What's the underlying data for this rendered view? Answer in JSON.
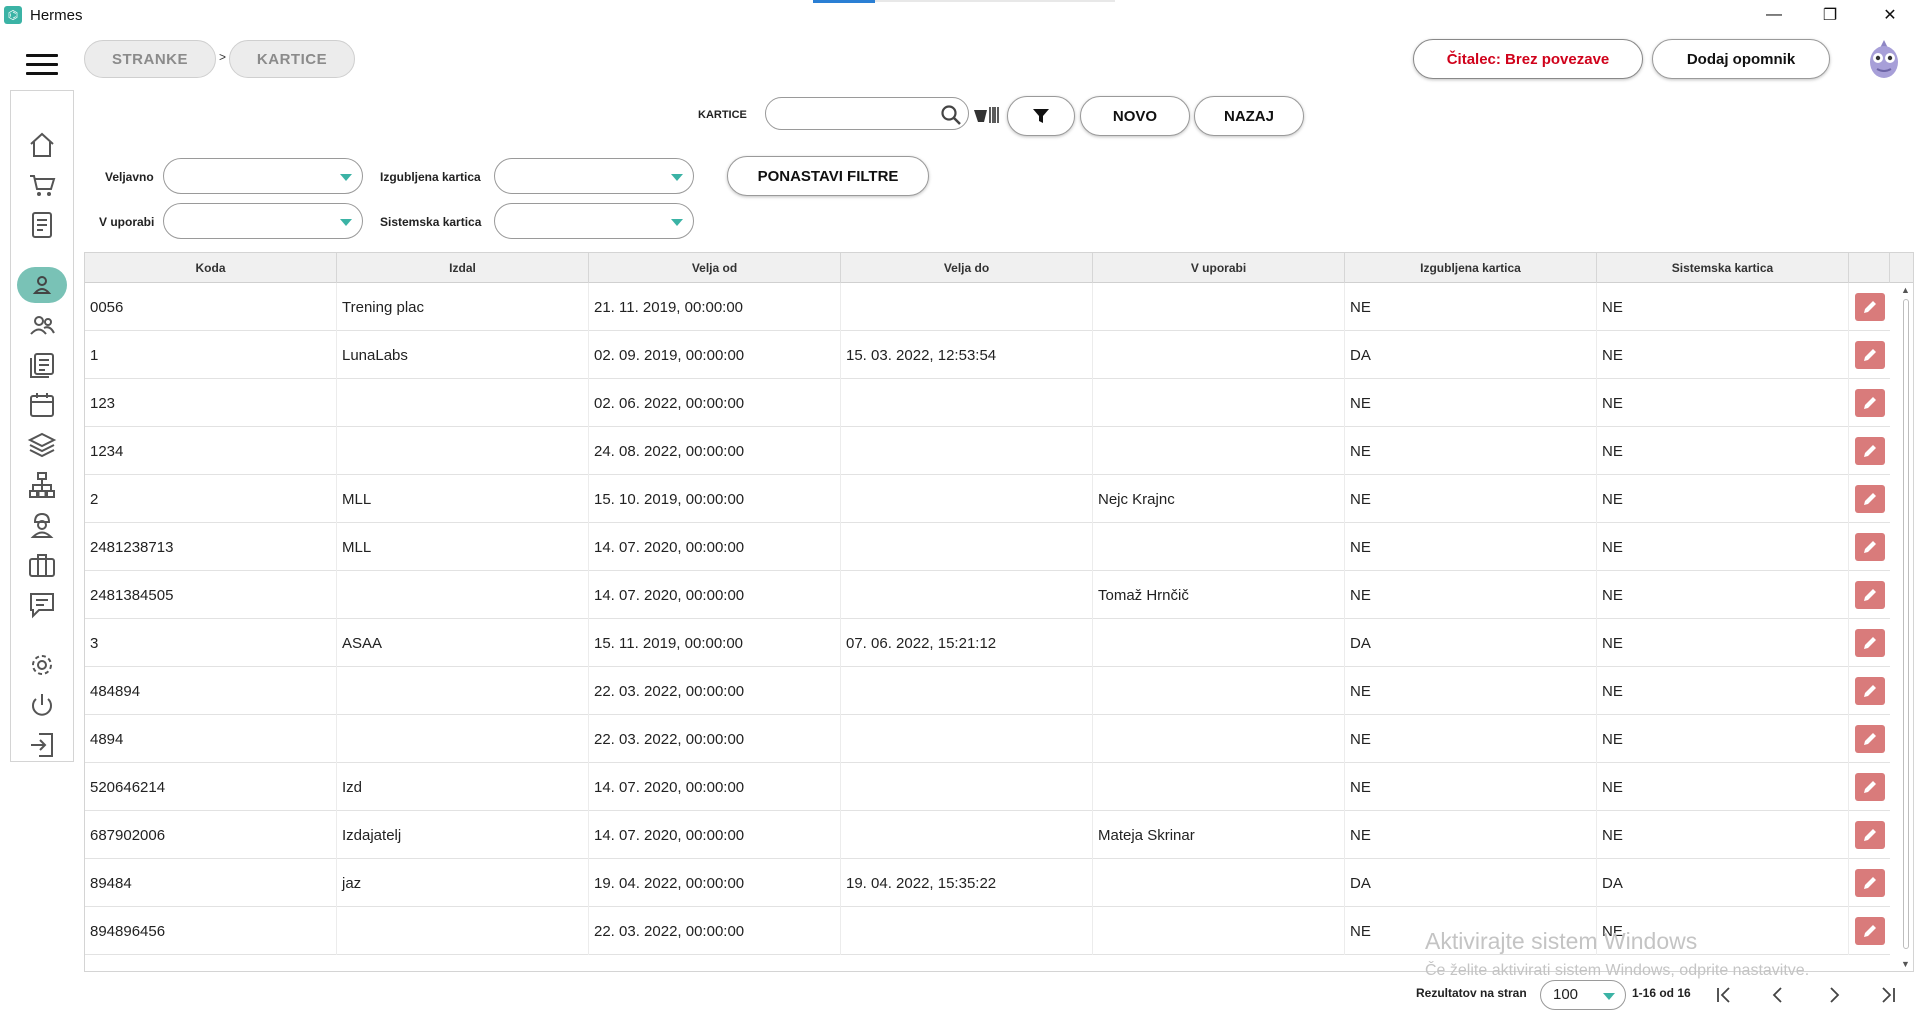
{
  "window": {
    "title": "Hermes",
    "minimize": "—",
    "restore": "❐",
    "close": "✕"
  },
  "breadcrumb": {
    "items": [
      "STRANKE",
      "KARTICE"
    ],
    "separator": ">"
  },
  "header": {
    "reader_status": "Čitalec: Brez povezave",
    "add_reminder": "Dodaj opomnik"
  },
  "search": {
    "label": "KARTICE",
    "value": "",
    "placeholder": ""
  },
  "toolbar": {
    "new_label": "NOVO",
    "back_label": "NAZAJ"
  },
  "filters": {
    "veljavno": {
      "label": "Veljavno",
      "value": ""
    },
    "izgubljena": {
      "label": "Izgubljena kartica",
      "value": ""
    },
    "v_uporabi": {
      "label": "V uporabi",
      "value": ""
    },
    "sistemska": {
      "label": "Sistemska kartica",
      "value": ""
    },
    "reset_label": "PONASTAVI FILTRE"
  },
  "table": {
    "columns": [
      "Koda",
      "Izdal",
      "Velja od",
      "Velja do",
      "V uporabi",
      "Izgubljena kartica",
      "Sistemska kartica"
    ],
    "rows": [
      [
        "0056",
        "Trening plac",
        "21. 11. 2019, 00:00:00",
        "",
        "",
        "NE",
        "NE"
      ],
      [
        "1",
        "LunaLabs",
        "02. 09. 2019, 00:00:00",
        "15. 03. 2022, 12:53:54",
        "",
        "DA",
        "NE"
      ],
      [
        "123",
        "",
        "02. 06. 2022, 00:00:00",
        "",
        "",
        "NE",
        "NE"
      ],
      [
        "1234",
        "",
        "24. 08. 2022, 00:00:00",
        "",
        "",
        "NE",
        "NE"
      ],
      [
        "2",
        "MLL",
        "15. 10. 2019, 00:00:00",
        "",
        "Nejc Krajnc",
        "NE",
        "NE"
      ],
      [
        "2481238713",
        "MLL",
        "14. 07. 2020, 00:00:00",
        "",
        "",
        "NE",
        "NE"
      ],
      [
        "2481384505",
        "",
        "14. 07. 2020, 00:00:00",
        "",
        "Tomaž Hrnčič",
        "NE",
        "NE"
      ],
      [
        "3",
        "ASAA",
        "15. 11. 2019, 00:00:00",
        "07. 06. 2022, 15:21:12",
        "",
        "DA",
        "NE"
      ],
      [
        "484894",
        "",
        "22. 03. 2022, 00:00:00",
        "",
        "",
        "NE",
        "NE"
      ],
      [
        "4894",
        "",
        "22. 03. 2022, 00:00:00",
        "",
        "",
        "NE",
        "NE"
      ],
      [
        "520646214",
        "Izd",
        "14. 07. 2020, 00:00:00",
        "",
        "",
        "NE",
        "NE"
      ],
      [
        "687902006",
        "Izdajatelj",
        "14. 07. 2020, 00:00:00",
        "",
        "Mateja Skrinar",
        "NE",
        "NE"
      ],
      [
        "89484",
        "jaz",
        "19. 04. 2022, 00:00:00",
        "19. 04. 2022, 15:35:22",
        "",
        "DA",
        "DA"
      ],
      [
        "894896456",
        "",
        "22. 03. 2022, 00:00:00",
        "",
        "",
        "NE",
        "NE"
      ]
    ]
  },
  "watermark": {
    "line1": "Aktivirajte sistem Windows",
    "line2": "Če želite aktivirati sistem Windows, odprite nastavitve."
  },
  "pager": {
    "label": "Rezultatov na stran",
    "page_size": "100",
    "range": "1-16 od 16"
  },
  "sidebar": {
    "items": [
      "home-icon",
      "cart-icon",
      "document-icon",
      "person-icon",
      "people-icon",
      "list-icon",
      "calendar-icon",
      "layers-icon",
      "network-icon",
      "worker-icon",
      "briefcase-icon",
      "chat-icon",
      "gear-icon",
      "power-icon",
      "logout-icon"
    ],
    "active": "person-icon"
  },
  "colors": {
    "accent": "#3bb3a5",
    "active_nav": "#79c2b6",
    "edit_button": "#d97b7b",
    "reader_status": "#d0021b"
  }
}
